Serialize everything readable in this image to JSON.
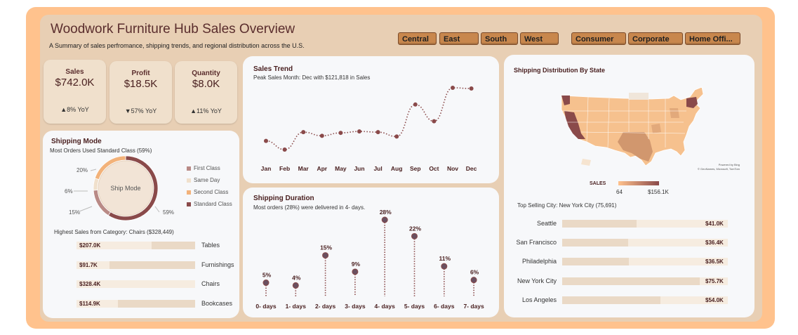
{
  "header": {
    "title": "Woodwork Furniture Hub Sales Overview",
    "subtitle": "A Summary of sales perfromance, shipping trends, and regional distribution across the U.S."
  },
  "slicers": {
    "regions": [
      "Central",
      "East",
      "South",
      "West"
    ],
    "segments": [
      "Consumer",
      "Corporate",
      "Home Offi..."
    ]
  },
  "kpis": [
    {
      "label": "Sales",
      "value": "$742.0K",
      "yoy": "▲8% YoY"
    },
    {
      "label": "Profit",
      "value": "$18.5K",
      "yoy": "▼57% YoY"
    },
    {
      "label": "Quantity",
      "value": "$8.0K",
      "yoy": "▲11% YoY"
    }
  ],
  "shipping_mode": {
    "title": "Shipping Mode",
    "subtitle": "Most Orders Used Standard Class (59%)",
    "center_label": "Ship Mode",
    "legend": [
      {
        "label": "First Class",
        "color": "#b98a86"
      },
      {
        "label": "Same Day",
        "color": "#f0e0cc"
      },
      {
        "label": "Second Class",
        "color": "#f2b27a"
      },
      {
        "label": "Standard Class",
        "color": "#8a4a4a"
      }
    ],
    "pct_labels": {
      "first": "15%",
      "same": "6%",
      "second": "20%",
      "standard": "59%"
    },
    "category_heading": "Highest Sales from Category: Chairs ($328,449)",
    "categories": [
      {
        "label": "Tables",
        "value": "$207.0K",
        "amount": 207.0
      },
      {
        "label": "Furnishings",
        "value": "$91.7K",
        "amount": 91.7
      },
      {
        "label": "Chairs",
        "value": "$328.4K",
        "amount": 328.4
      },
      {
        "label": "Bookcases",
        "value": "$114.9K",
        "amount": 114.9
      }
    ]
  },
  "sales_trend": {
    "title": "Sales Trend",
    "subtitle": "Peak Sales Month: Dec with $121,818 in Sales"
  },
  "shipping_duration": {
    "title": "Shipping Duration",
    "subtitle": "Most orders (28%) were delivered in 4- days."
  },
  "shipping_state": {
    "title": "Shipping Distribution By State",
    "legend_title": "SALES",
    "legend_min": "64",
    "legend_max": "$156.1K",
    "attribution_1": "Powered by Bing",
    "attribution_2": "© GeoNames, Microsoft, TomTom",
    "top_city": "Top Selling City: New York City (75,691)",
    "cities": [
      {
        "label": "Seattle",
        "value": "$41.0K",
        "amount": 41.0
      },
      {
        "label": "San Francisco",
        "value": "$36.4K",
        "amount": 36.4
      },
      {
        "label": "Philadelphia",
        "value": "$36.5K",
        "amount": 36.5
      },
      {
        "label": "New York City",
        "value": "$75.7K",
        "amount": 75.7
      },
      {
        "label": "Los Angeles",
        "value": "$54.0K",
        "amount": 54.0
      }
    ]
  },
  "chart_data": [
    {
      "type": "line",
      "categories": [
        "Jan",
        "Feb",
        "Mar",
        "Apr",
        "May",
        "Jun",
        "Jul",
        "Aug",
        "Sep",
        "Oct",
        "Nov",
        "Dec"
      ],
      "series": [
        {
          "values": [
            50,
            38,
            62,
            57,
            61,
            63,
            62,
            56,
            100,
            77,
            123,
            122
          ]
        }
      ],
      "note_unit": "K"
    },
    {
      "type": "scatter",
      "categories": [
        "0- days",
        "1- days",
        "2- days",
        "3- days",
        "4- days",
        "5- days",
        "6- days",
        "7- days"
      ],
      "values": [
        5,
        4,
        15,
        9,
        28,
        22,
        11,
        6
      ],
      "data_labels": [
        "5%",
        "4%",
        "15%",
        "9%",
        "28%",
        "22%",
        "11%",
        "6%"
      ]
    },
    {
      "type": "pie",
      "categories": [
        "First Class",
        "Same Day",
        "Second Class",
        "Standard Class"
      ],
      "values": [
        15,
        6,
        20,
        59
      ]
    }
  ]
}
